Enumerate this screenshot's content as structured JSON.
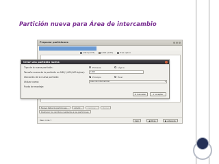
{
  "slide": {
    "title": "Partición nueva para Área de intercambio"
  },
  "window": {
    "title": "Preparar particiones",
    "legend": [
      {
        "label": "sda1 (ext3)",
        "color": "#6a9ad4"
      },
      {
        "label": "sda2 (ext3)",
        "color": "#d0a560"
      },
      {
        "label": "free space",
        "color": "#f2f1ed"
      }
    ],
    "toolbar": [
      "Nueva tabla de particiones...",
      "Añadir...",
      "Cambiar...",
      "Borrar"
    ],
    "undo_label": "Deshacer los cambios realizados a las particiones",
    "step": "Paso 4 de 7",
    "footer_buttons": {
      "quit": "Salir",
      "back": "Atrás",
      "forward": "Adelante"
    }
  },
  "dialog": {
    "title": "Crear una partición nueva",
    "type_label": "Tipo de la nueva partición:",
    "type_options": [
      "Primaria",
      "Lógica"
    ],
    "size_label": "Tamaño nuevo de la partición en MB (1,000,000 bytes):",
    "size_value": "1000",
    "location_label": "Ubicación de la nueva partición:",
    "location_options": [
      "Principio",
      "Final"
    ],
    "use_label": "Utilizar como:",
    "use_value": "área de intercambio",
    "mount_label": "Punto de montaje:",
    "cancel": "Cancelar",
    "ok": "Aceptar"
  }
}
